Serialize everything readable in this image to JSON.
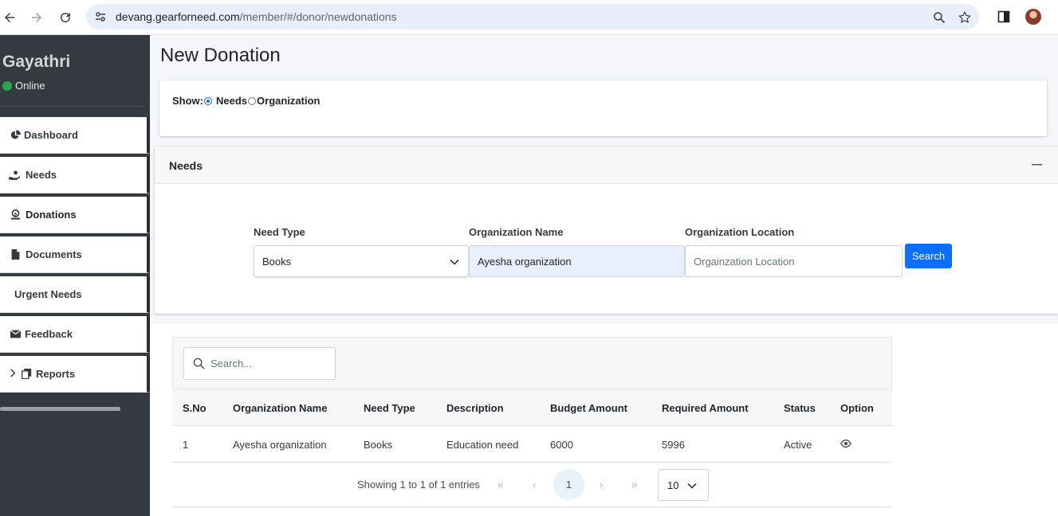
{
  "browser": {
    "url_host": "devang.gearforneed.com",
    "url_path": "/member/#/donor/newdonations"
  },
  "sidebar": {
    "user_name": "Gayathri",
    "status": "Online",
    "items": [
      {
        "label": "Dashboard",
        "icon": "pie-chart-icon"
      },
      {
        "label": "Needs",
        "icon": "hand-holding-icon"
      },
      {
        "label": "Donations",
        "icon": "donate-icon"
      },
      {
        "label": "Documents",
        "icon": "file-icon"
      },
      {
        "label": "Urgent Needs",
        "icon": ""
      },
      {
        "label": "Feedback",
        "icon": "envelope-icon"
      },
      {
        "label": "Reports",
        "icon": "copy-icon"
      }
    ]
  },
  "page": {
    "title": "New Donation"
  },
  "show_filter": {
    "label": "Show:",
    "options": [
      "Needs",
      "Organization"
    ],
    "selected": "Needs"
  },
  "needs_panel": {
    "title": "Needs",
    "collapse_icon": "minus-icon",
    "fields": {
      "need_type": {
        "label": "Need Type",
        "value": "Books"
      },
      "org_name": {
        "label": "Organization Name",
        "value": "Ayesha organization"
      },
      "org_location": {
        "label": "Organization Location",
        "placeholder": "Orgainzation Location"
      }
    },
    "search_button": "Search"
  },
  "table": {
    "search_placeholder": "Search...",
    "columns": [
      "S.No",
      "Organization Name",
      "Need Type",
      "Description",
      "Budget Amount",
      "Required Amount",
      "Status",
      "Option"
    ],
    "rows": [
      {
        "sno": "1",
        "org": "Ayesha organization",
        "need_type": "Books",
        "description": "Education need",
        "budget": "6000",
        "required": "5996",
        "status": "Active",
        "option_icon": "eye-icon"
      }
    ],
    "pagination": {
      "info": "Showing 1 to 1 of 1 entries",
      "first": "«",
      "prev": "‹",
      "current": "1",
      "next": "›",
      "last": "»",
      "page_size": "10"
    }
  },
  "colors": {
    "sidebar_bg": "#343a40",
    "accent": "#0d6efd",
    "online": "#28a745"
  }
}
